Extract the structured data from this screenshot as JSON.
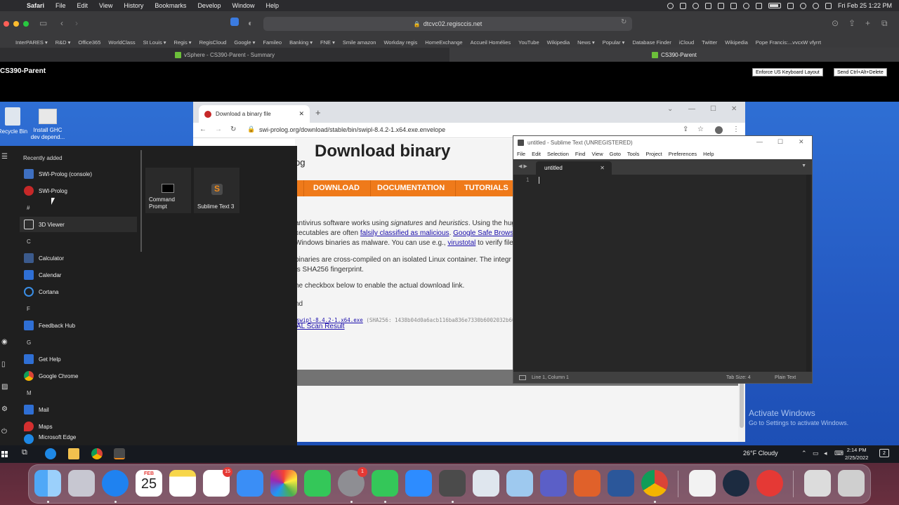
{
  "mac_menu": {
    "app": "Safari",
    "items": [
      "File",
      "Edit",
      "View",
      "History",
      "Bookmarks",
      "Develop",
      "Window",
      "Help"
    ],
    "datetime": "Fri Feb 25  1:22 PM"
  },
  "safari": {
    "address": "dtcvc02.regisccis.net",
    "bookmarks": [
      "InterPARES ▾",
      "R&D ▾",
      "Office365",
      "WorldClass",
      "St Louis ▾",
      "Regis ▾",
      "RegisCloud",
      "Google ▾",
      "Famileo",
      "Banking ▾",
      "FNE ▾",
      "Smile amazon",
      "Workday regis",
      "HomeExchange",
      "Accueil Homélies",
      "YouTube",
      "Wikipedia",
      "News ▾",
      "Popular ▾",
      "Database Finder",
      "iCloud",
      "Twitter",
      "Wikipedia",
      "Pope Francis:...vvcxW vfyrrt"
    ],
    "tabs": [
      "vSphere - CS390-Parent - Summary",
      "CS390-Parent"
    ]
  },
  "vsphere": {
    "title": "CS390-Parent",
    "keyboard_button": "Enforce US Keyboard Layout",
    "cad_button": "Send Ctrl+Alt+Delete"
  },
  "desktop": {
    "icons": [
      "Recycle Bin",
      "Install GHC dev depend..."
    ],
    "activate_title": "Activate Windows",
    "activate_sub": "Go to Settings to activate Windows."
  },
  "chrome": {
    "tab_title": "Download a binary file",
    "url": "swi-prolog.org/download/stable/bin/swipl-8.4.2-1.x64.exe.envelope",
    "page": {
      "heading": "Download binary",
      "og": "og",
      "nav": [
        "DOWNLOAD",
        "DOCUMENTATION",
        "TUTORIALS"
      ],
      "p1_l1_pre": "antivirus software works using ",
      "p1_l1_em1": "signatures",
      "p1_l1_mid": " and ",
      "p1_l1_em2": "heuristics",
      "p1_l1_post": ". Using the hug",
      "p1_l2_pre": "xecutables are often ",
      "p1_l2_link1": "falsily classified as malicious",
      "p1_l2_mid": ". ",
      "p1_l2_link2": "Google Safe Browsi",
      "p1_l3_pre": "Windows binaries as malware. You can use e.g., ",
      "p1_l3_link": "virustotal",
      "p1_l3_post": " to verify files",
      "p2_l1": "binaries are cross-compiled on an isolated Linux container. The integr",
      "p2_l2": "ts SHA256 fingerprint.",
      "p3": "he checkbox below to enable the actual download link.",
      "p4": "nd",
      "file_link": "swipl-8.4.2-1.x64.exe",
      "sha": "(SHA256: 1438b04d0a6acb116ba836e7330b6002032b60",
      "scan_link": "AL Scan Result"
    }
  },
  "start_menu": {
    "recently_added": "Recently added",
    "letters": [
      "#",
      "C",
      "F",
      "G",
      "M"
    ],
    "items": [
      "SWI-Prolog (console)",
      "SWI-Prolog",
      "3D Viewer",
      "Calculator",
      "Calendar",
      "Cortana",
      "Feedback Hub",
      "Get Help",
      "Google Chrome",
      "Mail",
      "Maps",
      "Microsoft Edge"
    ],
    "tiles": [
      "Command Prompt",
      "Sublime Text 3"
    ]
  },
  "sublime": {
    "title": "untitled - Sublime Text (UNREGISTERED)",
    "menu": [
      "File",
      "Edit",
      "Selection",
      "Find",
      "View",
      "Goto",
      "Tools",
      "Project",
      "Preferences",
      "Help"
    ],
    "tab": "untitled",
    "line_number": "1",
    "status_left": "Line 1, Column 1",
    "tab_size": "Tab Size: 4",
    "syntax": "Plain Text"
  },
  "taskbar": {
    "weather": "26°F  Cloudy",
    "time": "2:14 PM",
    "date": "2/25/2022",
    "notifications": "2"
  },
  "dock": {
    "calendar_month": "FEB",
    "calendar_day": "25",
    "reminders_badge": "15",
    "settings_badge": "1"
  }
}
